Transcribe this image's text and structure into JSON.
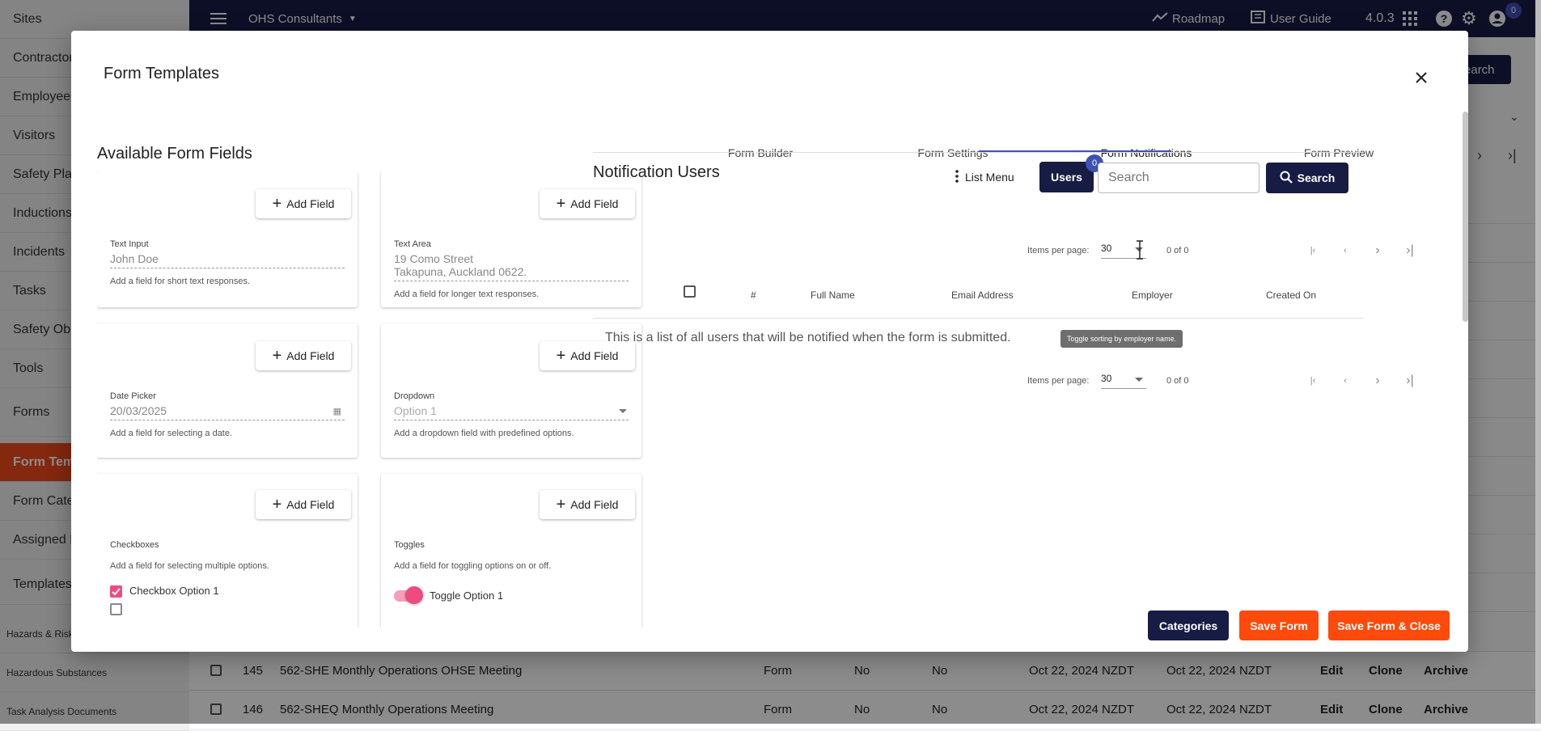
{
  "sidebar": {
    "items": [
      "Sites",
      "Contractors",
      "Employees",
      "Visitors",
      "Safety Plans",
      "Inductions",
      "Incidents",
      "Tasks",
      "Safety Obs",
      "Tools",
      "Forms",
      "Form Temp",
      "Form Categ",
      "Assigned F",
      "Templates",
      "Hazards & Risk",
      "Hazardous Substances",
      "Task Analysis Documents"
    ],
    "active": "Form Temp"
  },
  "topbar": {
    "org": "OHS Consultants",
    "roadmap": "Roadmap",
    "user_guide": "User Guide",
    "version": "4.0.3",
    "notif_count": "0"
  },
  "background": {
    "search_label": "Search",
    "rows": [
      {
        "num": "145",
        "name": "562-SHE Monthly Operations OHSE Meeting",
        "type": "Form",
        "a": "No",
        "b": "No",
        "created": "Oct 22, 2024 NZDT",
        "updated": "Oct 22, 2024 NZDT",
        "edit": "Edit",
        "clone": "Clone",
        "archive": "Archive"
      },
      {
        "num": "146",
        "name": "562-SHEQ Monthly Operations Meeting",
        "type": "Form",
        "a": "No",
        "b": "No",
        "created": "Oct 22, 2024 NZDT",
        "updated": "Oct 22, 2024 NZDT",
        "edit": "Edit",
        "clone": "Clone",
        "archive": "Archive"
      }
    ]
  },
  "modal": {
    "title": "Form Templates",
    "available_title": "Available Form Fields",
    "add_field_label": "Add Field",
    "fields": {
      "text_input": {
        "label": "Text Input",
        "value": "John Doe",
        "desc": "Add a field for short text responses."
      },
      "text_area": {
        "label": "Text Area",
        "value1": "19 Como Street",
        "value2": "Takapuna, Auckland 0622.",
        "desc": "Add a field for longer text responses."
      },
      "date_picker": {
        "label": "Date Picker",
        "value": "20/03/2025",
        "desc": "Add a field for selecting a date."
      },
      "dropdown": {
        "label": "Dropdown",
        "value": "Option 1",
        "desc": "Add a dropdown field with predefined options."
      },
      "checkboxes": {
        "label": "Checkboxes",
        "desc": "Add a field for selecting multiple options.",
        "option1": "Checkbox Option 1",
        "option1_checked": true
      },
      "toggles": {
        "label": "Toggles",
        "desc": "Add a field for toggling options on or off.",
        "option1": "Toggle Option 1",
        "option1_on": true
      }
    },
    "tabs": [
      "Form Builder",
      "Form Settings",
      "Form Notifications",
      "Form Preview"
    ],
    "active_tab": "Form Notifications",
    "notifications": {
      "title": "Notification Users",
      "list_menu": "List Menu",
      "users_label": "Users",
      "users_count": "0",
      "search_placeholder": "Search",
      "search_button": "Search",
      "items_per_page_label": "Items per page:",
      "items_per_page": "30",
      "range": "0 of 0",
      "columns": [
        "#",
        "Full Name",
        "Email Address",
        "Employer",
        "Created On"
      ],
      "empty_message": "This is a list of all users that will be notified when the form is submitted.",
      "tooltip": "Toggle sorting by employer name."
    },
    "footer": {
      "categories": "Categories",
      "save_form": "Save Form",
      "save_close": "Save Form & Close"
    },
    "colors": {
      "navy": "#171c45",
      "orange": "#fe4a0a",
      "indigo": "#3f51b5",
      "pink": "#ee4b7e"
    }
  }
}
